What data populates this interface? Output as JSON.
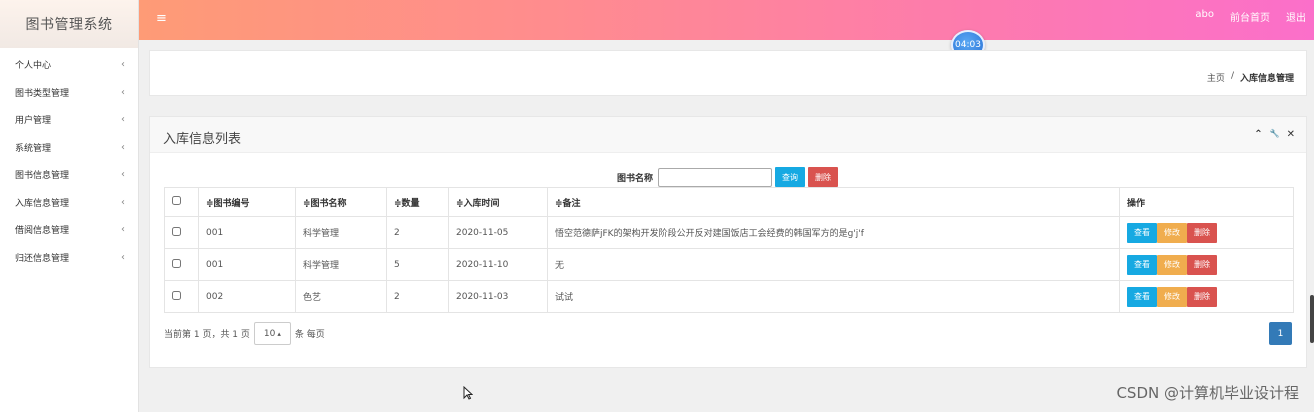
{
  "brand": "图书管理系统",
  "sidebar": {
    "items": [
      {
        "label": "个人中心"
      },
      {
        "label": "图书类型管理"
      },
      {
        "label": "用户管理"
      },
      {
        "label": "系统管理"
      },
      {
        "label": "图书信息管理"
      },
      {
        "label": "入库信息管理"
      },
      {
        "label": "借阅信息管理"
      },
      {
        "label": "归还信息管理"
      }
    ],
    "chevron": "‹"
  },
  "topbar": {
    "menu_icon": "≡",
    "user": "abo",
    "home_link": "前台首页",
    "logout": "退出"
  },
  "timer": "04:03",
  "breadcrumb": {
    "home": "主页",
    "separator": "/",
    "current": "入库信息管理"
  },
  "panel": {
    "title": "入库信息列表",
    "tools": {
      "collapse": "⌃",
      "wrench": "🔧",
      "close": "✕"
    }
  },
  "search": {
    "label": "图书名称",
    "value": "",
    "search_btn": "查询",
    "delete_btn": "删除"
  },
  "table": {
    "headers": [
      "",
      "≑图书编号",
      "≑图书名称",
      "≑数量",
      "≑入库时间",
      "≑备注",
      "操作"
    ],
    "rows": [
      {
        "code": "001",
        "name": "科学管理",
        "qty": "2",
        "date": "2020-11-05",
        "note": "悟空范德萨jFK的架构开发阶段公开反对建国饭店工会经费的韩国军方的是g'j'f"
      },
      {
        "code": "001",
        "name": "科学管理",
        "qty": "5",
        "date": "2020-11-10",
        "note": "无"
      },
      {
        "code": "002",
        "name": "色艺",
        "qty": "2",
        "date": "2020-11-03",
        "note": "试试"
      }
    ],
    "actions": {
      "view": "查看",
      "edit": "修改",
      "delete": "删除"
    }
  },
  "pagination": {
    "summary": "当前第 1 页，共 1 页",
    "page_size": "10",
    "page_size_caret": "▴",
    "per_page": "条 每页",
    "current_page": "1"
  },
  "watermark": "CSDN @计算机毕业设计程",
  "colors": {
    "topbar_start": "#fe9b76",
    "topbar_end": "#fb6fca",
    "blue": "#16a9e2",
    "orange": "#f0ad4e",
    "red": "#d9534f",
    "page": "#337ab7"
  }
}
